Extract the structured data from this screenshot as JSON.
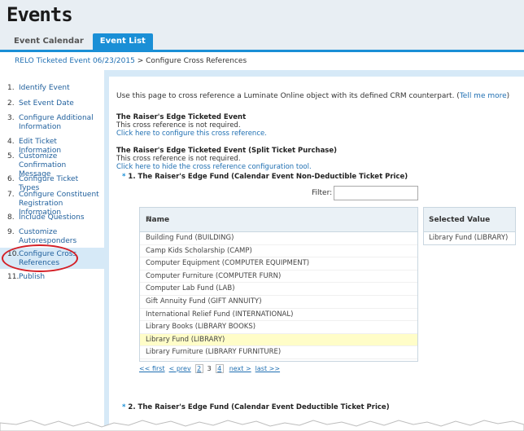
{
  "header": {
    "title": "Events",
    "tabs": [
      {
        "label": "Event Calendar",
        "active": false
      },
      {
        "label": "Event List",
        "active": true
      }
    ]
  },
  "breadcrumb": {
    "link": "RELO Ticketed Event 06/23/2015",
    "separator": " > ",
    "current": "Configure Cross References"
  },
  "sidebar": {
    "steps": [
      {
        "num": "1.",
        "label": "Identify Event"
      },
      {
        "num": "2.",
        "label": "Set Event Date"
      },
      {
        "num": "3.",
        "label": "Configure Additional Information"
      },
      {
        "num": "4.",
        "label": "Edit Ticket Information"
      },
      {
        "num": "5.",
        "label": "Customize Confirmation Message"
      },
      {
        "num": "6.",
        "label": "Configure Ticket Types"
      },
      {
        "num": "7.",
        "label": "Configure Constituent Registration Information"
      },
      {
        "num": "8.",
        "label": "Include Questions"
      },
      {
        "num": "9.",
        "label": "Customize Autoresponders"
      },
      {
        "num": "10.",
        "label": "Configure Cross References"
      },
      {
        "num": "11.",
        "label": "Publish"
      }
    ]
  },
  "main": {
    "intro": "Use this page to cross reference a Luminate Online object with its defined CRM counterpart. (",
    "intro_link": "Tell me more",
    "intro_end": ")",
    "block1": {
      "title": "The Raiser's Edge Ticketed Event",
      "note": "This cross reference is not required.",
      "link": "Click here to configure this cross reference."
    },
    "block2": {
      "title": "The Raiser's Edge Ticketed Event (Split Ticket Purchase)",
      "note": "This cross reference is not required.",
      "link": "Click here to hide the cross reference configuration tool."
    },
    "fund1": {
      "star": "*",
      "title": "1.  The Raiser's Edge Fund (Calendar Event Non-Deductible Ticket Price)"
    },
    "filter_label": "Filter:",
    "filter_value": "",
    "list": {
      "header": "Name",
      "sort_icon": "⇕",
      "rows": [
        "Building Fund (BUILDING)",
        "Camp Kids Scholarship (CAMP)",
        "Computer Equipment (COMPUTER EQUIPMENT)",
        "Computer Furniture (COMPUTER FURN)",
        "Computer Lab Fund (LAB)",
        "Gift Annuity Fund (GIFT ANNUITY)",
        "International Relief Fund (INTERNATIONAL)",
        "Library Books (LIBRARY BOOKS)",
        "Library Fund (LIBRARY)",
        "Library Furniture (LIBRARY FURNITURE)"
      ],
      "selected_index": 8
    },
    "selected": {
      "header": "Selected Value",
      "value": "Library Fund (LIBRARY)"
    },
    "pager": {
      "first": "<< first",
      "prev": "< prev",
      "pages": [
        "2",
        "3",
        "4"
      ],
      "current": "3",
      "next": "next >",
      "last": "last >>"
    },
    "fund2": {
      "star": "*",
      "title": "2.  The Raiser's Edge Fund (Calendar Event Deductible Ticket Price)"
    }
  },
  "colors": {
    "accent": "#1a8fd6",
    "link": "#1f6fb2",
    "highlight_ring": "#d41f26",
    "selected_row": "#fffdc8"
  }
}
